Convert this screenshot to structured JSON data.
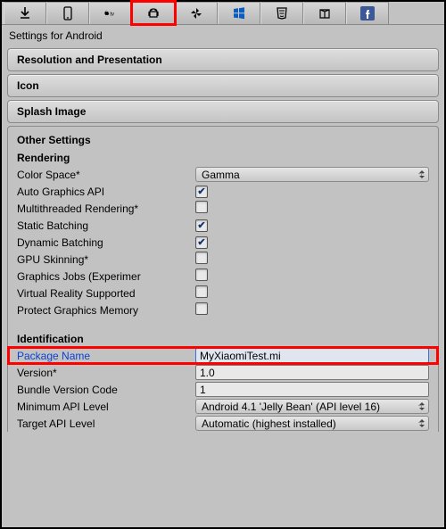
{
  "tabs": [
    {
      "name": "standalone",
      "icon": "download"
    },
    {
      "name": "ios",
      "icon": "phone"
    },
    {
      "name": "appletv",
      "icon": "appletv"
    },
    {
      "name": "android",
      "icon": "android",
      "selected": true,
      "highlight": "red"
    },
    {
      "name": "tizen",
      "icon": "pinwheel"
    },
    {
      "name": "windows",
      "icon": "windows"
    },
    {
      "name": "webgl",
      "icon": "html5"
    },
    {
      "name": "test",
      "icon": "box"
    },
    {
      "name": "facebook",
      "icon": "facebook"
    }
  ],
  "subtitle": "Settings for Android",
  "collapsed_sections": {
    "resolution": "Resolution and Presentation",
    "icon": "Icon",
    "splash": "Splash Image"
  },
  "open_section_title": "Other Settings",
  "rendering": {
    "title": "Rendering",
    "color_space_label": "Color Space*",
    "color_space_value": "Gamma",
    "auto_gfx_label": "Auto Graphics API",
    "auto_gfx_checked": true,
    "mt_render_label": "Multithreaded Rendering*",
    "mt_render_checked": false,
    "static_batch_label": "Static Batching",
    "static_batch_checked": true,
    "dyn_batch_label": "Dynamic Batching",
    "dyn_batch_checked": true,
    "gpu_skin_label": "GPU Skinning*",
    "gpu_skin_checked": false,
    "gfx_jobs_label": "Graphics Jobs (Experimer",
    "gfx_jobs_checked": false,
    "vr_label": "Virtual Reality Supported",
    "vr_checked": false,
    "protect_mem_label": "Protect Graphics Memory",
    "protect_mem_checked": false
  },
  "identification": {
    "title": "Identification",
    "package_label": "Package Name",
    "package_value": "MyXiaomiTest.mi",
    "version_label": "Version*",
    "version_value": "1.0",
    "bvc_label": "Bundle Version Code",
    "bvc_value": "1",
    "min_api_label": "Minimum API Level",
    "min_api_value": "Android 4.1 'Jelly Bean' (API level 16)",
    "tgt_api_label": "Target API Level",
    "tgt_api_value": "Automatic (highest installed)"
  }
}
